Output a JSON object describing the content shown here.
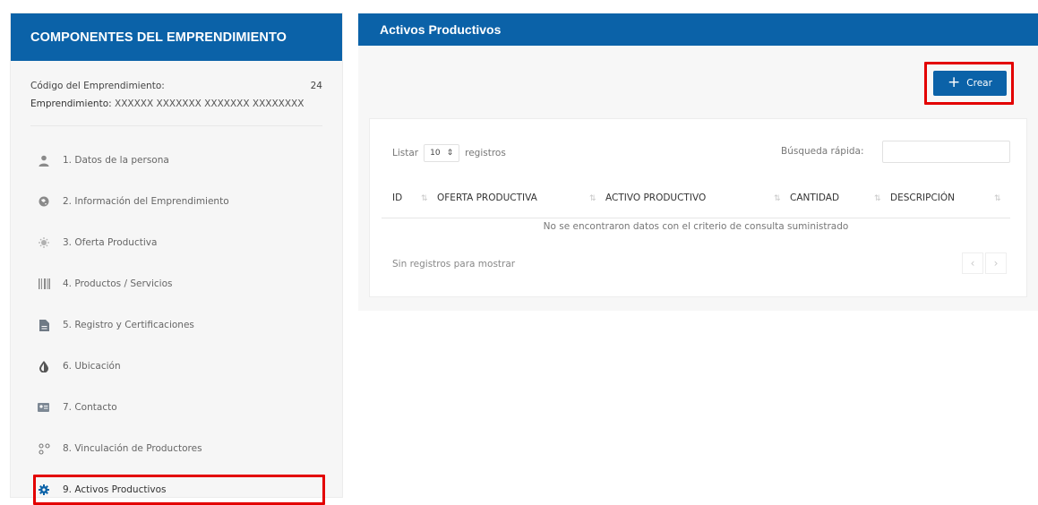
{
  "left_panel": {
    "title": "COMPONENTES DEL EMPRENDIMIENTO",
    "codigo_label": "Código del Emprendimiento:",
    "codigo_value": "24",
    "emprendimiento_label": "Emprendimiento:",
    "emprendimiento_value": "XXXXXX XXXXXXX XXXXXXX XXXXXXXX",
    "menu": [
      {
        "label": "1. Datos de la persona",
        "icon": "person-icon"
      },
      {
        "label": "2. Información del Emprendimiento",
        "icon": "globe-icon"
      },
      {
        "label": "3. Oferta Productiva",
        "icon": "sun-icon"
      },
      {
        "label": "4. Productos / Servicios",
        "icon": "barcode-icon"
      },
      {
        "label": "5. Registro y Certificaciones",
        "icon": "document-icon"
      },
      {
        "label": "6. Ubicación",
        "icon": "drop-icon"
      },
      {
        "label": "7. Contacto",
        "icon": "contact-card-icon"
      },
      {
        "label": "8. Vinculación de Productores",
        "icon": "network-icon"
      },
      {
        "label": "9. Activos Productivos",
        "icon": "gear-icon"
      }
    ]
  },
  "main": {
    "title": "Activos Productivos",
    "create_button": "Crear",
    "listar_label": "Listar",
    "page_size": "10",
    "registros_label": "registros",
    "search_label": "Búsqueda rápida:",
    "search_value": "",
    "columns": [
      "ID",
      "OFERTA PRODUCTIVA",
      "ACTIVO PRODUCTIVO",
      "CANTIDAD",
      "DESCRIPCIÓN"
    ],
    "empty_message": "No se encontraron datos con el criterio de consulta suministrado",
    "footer_info": "Sin registros para mostrar",
    "pager_prev": "‹",
    "pager_next": "›"
  },
  "colors": {
    "primary": "#0b62a8",
    "highlight": "#e30000"
  }
}
